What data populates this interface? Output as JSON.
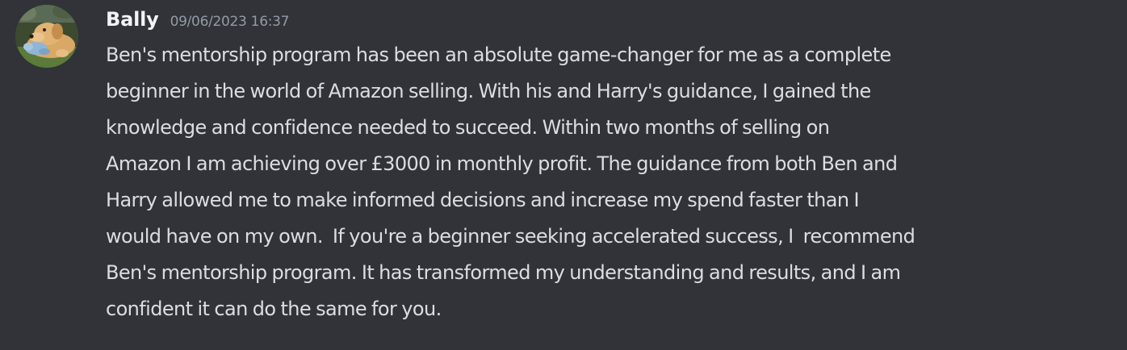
{
  "message": {
    "author": "Bally",
    "timestamp": "09/06/2023 16:37",
    "avatar_icon": "dog-avatar-icon",
    "lines": [
      "Ben's mentorship program has been an absolute game-changer for me as a complete",
      "beginner in the world of Amazon selling. With his and Harry's guidance, I gained the",
      "knowledge and confidence needed to succeed. Within two months of selling on",
      "Amazon I am achieving over £3000 in monthly profit. The guidance from both Ben and",
      "Harry allowed me to make informed decisions and increase my spend faster than I",
      "would have on my own.  If you're a beginner seeking accelerated success, I  recommend",
      "Ben's mentorship program. It has transformed my understanding and results, and I am",
      "confident it can do the same for you."
    ]
  },
  "colors": {
    "background": "#313338",
    "username": "#f2f3f5",
    "timestamp": "#949ba4",
    "message_text": "#dbdee1"
  }
}
